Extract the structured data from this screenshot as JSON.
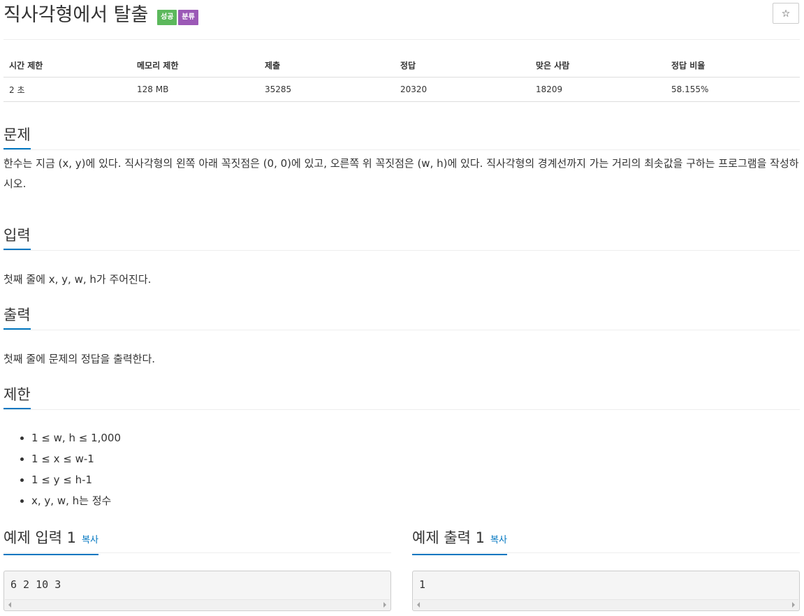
{
  "problem": {
    "title": "직사각형에서 탈출",
    "badges": {
      "success": "성공",
      "category": "분류"
    },
    "star": "☆"
  },
  "info_table": {
    "headers": [
      "시간 제한",
      "메모리 제한",
      "제출",
      "정답",
      "맞은 사람",
      "정답 비율"
    ],
    "values": [
      "2 초",
      "128 MB",
      "35285",
      "20320",
      "18209",
      "58.155%"
    ]
  },
  "sections": {
    "problem": {
      "heading": "문제",
      "text": "한수는 지금 (x, y)에 있다. 직사각형의 왼쪽 아래 꼭짓점은 (0, 0)에 있고, 오른쪽 위 꼭짓점은 (w, h)에 있다. 직사각형의 경계선까지 가는 거리의 최솟값을 구하는 프로그램을 작성하시오."
    },
    "input": {
      "heading": "입력",
      "text": "첫째 줄에 x, y, w, h가 주어진다."
    },
    "output": {
      "heading": "출력",
      "text": "첫째 줄에 문제의 정답을 출력한다."
    },
    "limits": {
      "heading": "제한",
      "items": [
        "1 ≤ w, h ≤ 1,000",
        "1 ≤ x ≤ w-1",
        "1 ≤ y ≤ h-1",
        "x, y, w, h는 정수"
      ]
    }
  },
  "samples": {
    "input": {
      "heading": "예제 입력 1",
      "copy": "복사",
      "content": "6 2 10 3"
    },
    "output": {
      "heading": "예제 출력 1",
      "copy": "복사",
      "content": "1"
    }
  }
}
